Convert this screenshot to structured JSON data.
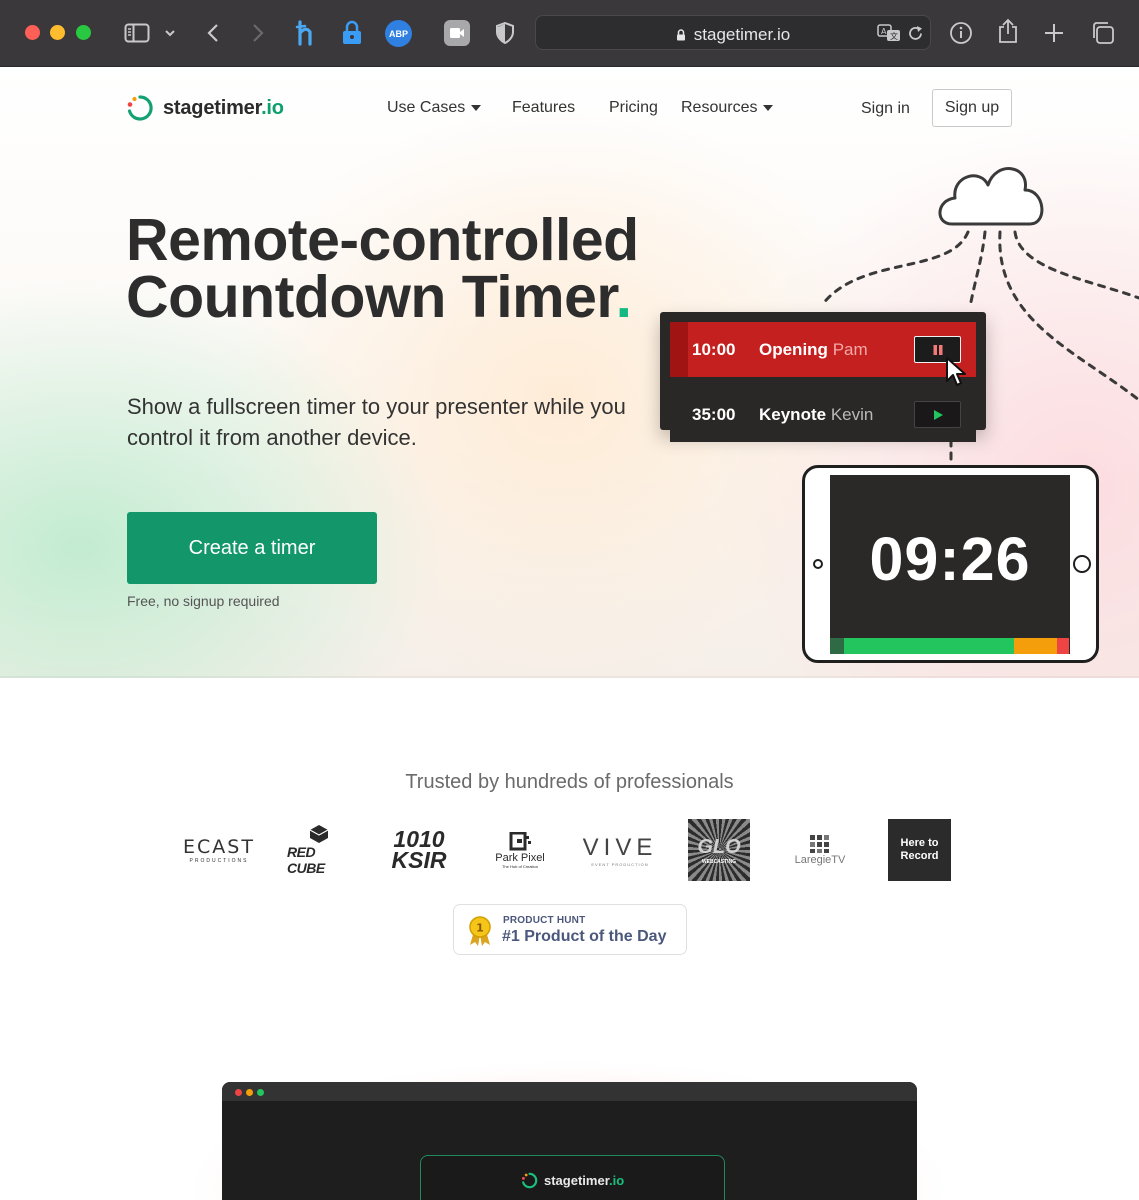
{
  "browser": {
    "url": "stagetimer.io"
  },
  "site": {
    "logo_name": "stagetimer",
    "logo_tld": ".io"
  },
  "nav": {
    "use_cases": "Use Cases",
    "features": "Features",
    "pricing": "Pricing",
    "resources": "Resources",
    "sign_in": "Sign in",
    "sign_up": "Sign up"
  },
  "hero": {
    "headline_line1": "Remote-controlled",
    "headline_line2": "Countdown Timer",
    "headline_dot": ".",
    "subtitle": "Show a fullscreen timer to your presenter while you control it from another device.",
    "cta": "Create a timer",
    "cta_note": "Free, no signup required"
  },
  "illustration": {
    "cues": [
      {
        "time": "10:00",
        "title": "Opening",
        "speaker": "Pam",
        "state": "playing"
      },
      {
        "time": "35:00",
        "title": "Keynote",
        "speaker": "Kevin",
        "state": "stopped"
      }
    ],
    "display_time": "09:26",
    "progress_segments": [
      {
        "color": "#2e6b45",
        "fraction": 0.06
      },
      {
        "color": "#22c55e",
        "fraction": 0.71
      },
      {
        "color": "#f59e0b",
        "fraction": 0.18
      },
      {
        "color": "#ef4444",
        "fraction": 0.05
      }
    ]
  },
  "trusted": {
    "heading": "Trusted by hundreds of professionals",
    "brands": [
      {
        "name": "ECAST",
        "sub": "PRODUCTIONS"
      },
      {
        "name": "RED CUBE"
      },
      {
        "name": "1010",
        "sub": "KSIR"
      },
      {
        "name": "Park Pixel",
        "sub": "The Hub of Creation"
      },
      {
        "name": "VIVE",
        "sub": "EVENT PRODUCTION"
      },
      {
        "name": "GLO",
        "sub": "WEBCASTING"
      },
      {
        "name": "LaregieTV"
      },
      {
        "name": "Here to",
        "sub": "Record"
      }
    ],
    "product_hunt_kicker": "PRODUCT HUNT",
    "product_hunt_title": "#1 Product of the Day"
  },
  "preview": {
    "logo_name": "stagetimer",
    "logo_tld": ".io"
  },
  "colors": {
    "brand_green": "#13976a",
    "accent_green": "#13b883",
    "cue_red": "#c4201f",
    "product_hunt_text": "#4b587c"
  }
}
